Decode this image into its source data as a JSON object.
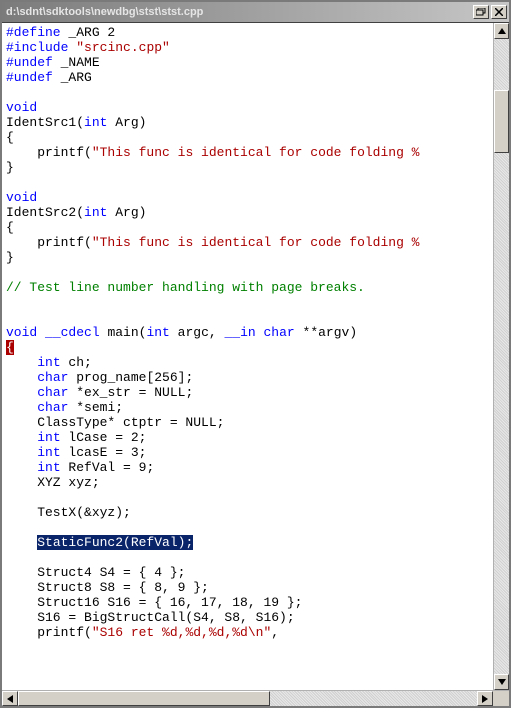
{
  "window": {
    "title": "d:\\sdnt\\sdktools\\newdbg\\stst\\stst.cpp"
  },
  "code_lines": [
    [
      [
        "pp",
        "#define"
      ],
      [
        "plain",
        " _ARG 2"
      ]
    ],
    [
      [
        "pp",
        "#include"
      ],
      [
        "plain",
        " "
      ],
      [
        "str",
        "\"srcinc.cpp\""
      ]
    ],
    [
      [
        "pp",
        "#undef"
      ],
      [
        "plain",
        " _NAME"
      ]
    ],
    [
      [
        "pp",
        "#undef"
      ],
      [
        "plain",
        " _ARG"
      ]
    ],
    [
      [
        "plain",
        ""
      ]
    ],
    [
      [
        "kw",
        "void"
      ]
    ],
    [
      [
        "plain",
        "IdentSrc1("
      ],
      [
        "kw",
        "int"
      ],
      [
        "plain",
        " Arg)"
      ]
    ],
    [
      [
        "plain",
        "{"
      ]
    ],
    [
      [
        "plain",
        "    printf("
      ],
      [
        "str",
        "\"This func is identical for code folding %"
      ]
    ],
    [
      [
        "plain",
        "}"
      ]
    ],
    [
      [
        "plain",
        ""
      ]
    ],
    [
      [
        "kw",
        "void"
      ]
    ],
    [
      [
        "plain",
        "IdentSrc2("
      ],
      [
        "kw",
        "int"
      ],
      [
        "plain",
        " Arg)"
      ]
    ],
    [
      [
        "plain",
        "{"
      ]
    ],
    [
      [
        "plain",
        "    printf("
      ],
      [
        "str",
        "\"This func is identical for code folding %"
      ]
    ],
    [
      [
        "plain",
        "}"
      ]
    ],
    [
      [
        "plain",
        ""
      ]
    ],
    [
      [
        "cmt",
        "// Test line number handling with page breaks."
      ]
    ],
    [
      [
        "plain",
        ""
      ]
    ],
    [
      [
        "plain",
        ""
      ]
    ],
    [
      [
        "kw",
        "void"
      ],
      [
        "plain",
        " "
      ],
      [
        "kw",
        "__cdecl"
      ],
      [
        "plain",
        " main("
      ],
      [
        "kw",
        "int"
      ],
      [
        "plain",
        " argc, "
      ],
      [
        "kw",
        "__in"
      ],
      [
        "plain",
        " "
      ],
      [
        "kw",
        "char"
      ],
      [
        "plain",
        " **argv)"
      ]
    ],
    [
      [
        "hl-cur",
        "{"
      ]
    ],
    [
      [
        "plain",
        "    "
      ],
      [
        "kw",
        "int"
      ],
      [
        "plain",
        " ch;"
      ]
    ],
    [
      [
        "plain",
        "    "
      ],
      [
        "kw",
        "char"
      ],
      [
        "plain",
        " prog_name[256];"
      ]
    ],
    [
      [
        "plain",
        "    "
      ],
      [
        "kw",
        "char"
      ],
      [
        "plain",
        " *ex_str = NULL;"
      ]
    ],
    [
      [
        "plain",
        "    "
      ],
      [
        "kw",
        "char"
      ],
      [
        "plain",
        " *semi;"
      ]
    ],
    [
      [
        "plain",
        "    ClassType* ctptr = NULL;"
      ]
    ],
    [
      [
        "plain",
        "    "
      ],
      [
        "kw",
        "int"
      ],
      [
        "plain",
        " lCase = 2;"
      ]
    ],
    [
      [
        "plain",
        "    "
      ],
      [
        "kw",
        "int"
      ],
      [
        "plain",
        " lcasE = 3;"
      ]
    ],
    [
      [
        "plain",
        "    "
      ],
      [
        "kw",
        "int"
      ],
      [
        "plain",
        " RefVal = 9;"
      ]
    ],
    [
      [
        "plain",
        "    XYZ xyz;"
      ]
    ],
    [
      [
        "plain",
        ""
      ]
    ],
    [
      [
        "plain",
        "    TestX(&xyz);"
      ]
    ],
    [
      [
        "plain",
        ""
      ]
    ],
    [
      [
        "plain",
        "    "
      ],
      [
        "sel",
        "StaticFunc2(RefVal);"
      ]
    ],
    [
      [
        "plain",
        ""
      ]
    ],
    [
      [
        "plain",
        "    Struct4 S4 = { 4 };"
      ]
    ],
    [
      [
        "plain",
        "    Struct8 S8 = { 8, 9 };"
      ]
    ],
    [
      [
        "plain",
        "    Struct16 S16 = { 16, 17, 18, 19 };"
      ]
    ],
    [
      [
        "plain",
        "    S16 = BigStructCall(S4, S8, S16);"
      ]
    ],
    [
      [
        "plain",
        "    printf("
      ],
      [
        "str",
        "\"S16 ret %d,%d,%d,%d\\n\""
      ],
      [
        "plain",
        ","
      ]
    ]
  ],
  "scroll": {
    "v_thumb_top_pct": 8,
    "v_thumb_height_pct": 10,
    "h_thumb_left_pct": 0,
    "h_thumb_width_pct": 55
  }
}
